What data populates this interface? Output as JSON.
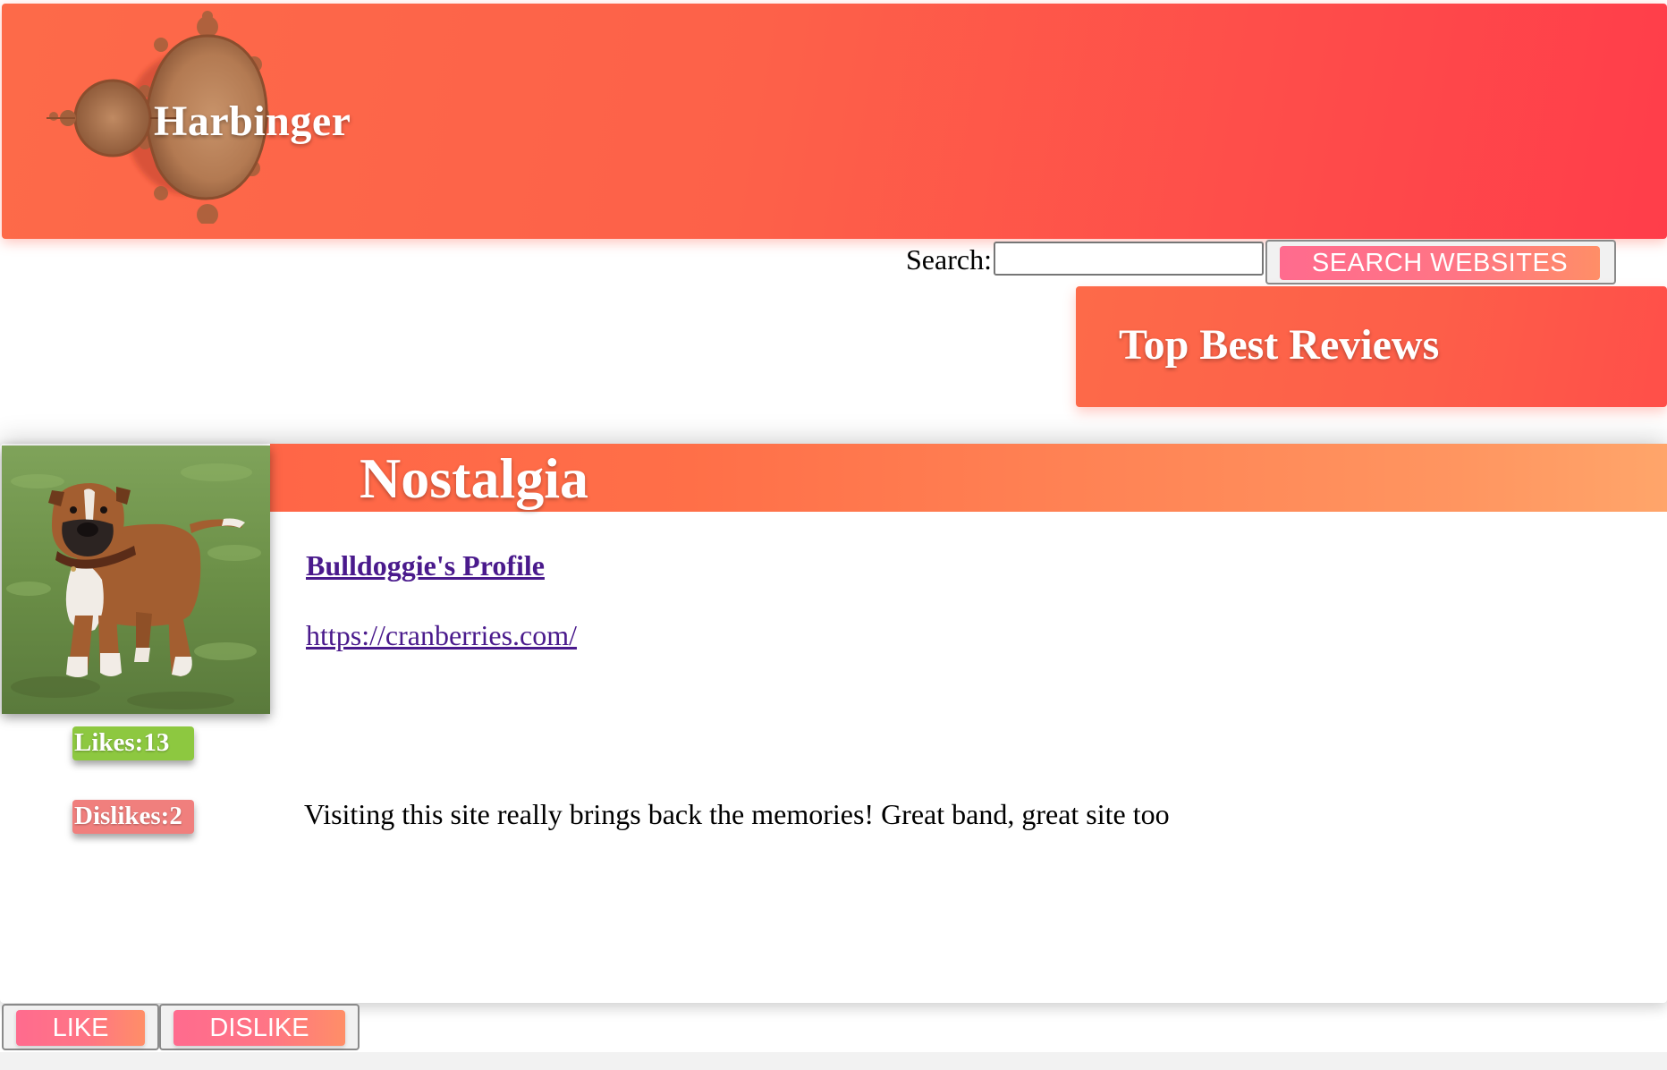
{
  "header": {
    "site_title": "Harbinger",
    "logo_icon": "mandelbrot-fractal-logo",
    "gradient": [
      "#fd6a49",
      "#ff3d4a"
    ]
  },
  "search": {
    "label": "Search:",
    "value": "",
    "placeholder": "",
    "button_label": "SEARCH WEBSITES"
  },
  "reviews_banner": {
    "title": "Top Best Reviews"
  },
  "review": {
    "title": "Nostalgia",
    "photo": "bulldog-photo",
    "profile_link": "Bulldoggie's Profile",
    "website_url": "https://cranberries.com/",
    "likes_label": "Likes:13",
    "dislikes_label": "Dislikes:2",
    "likes": 13,
    "dislikes": 2,
    "text": "Visiting this site really brings back the memories! Great band, great site too"
  },
  "actions": {
    "like_label": "LIKE",
    "dislike_label": "DISLIKE"
  },
  "colors": {
    "accent": "#fd6149",
    "link": "#4a1a8c",
    "likes_badge": "#8dc840",
    "dislikes_badge": "#f07f7d",
    "button_gradient": [
      "#ff6b8e",
      "#ff8e67"
    ]
  }
}
